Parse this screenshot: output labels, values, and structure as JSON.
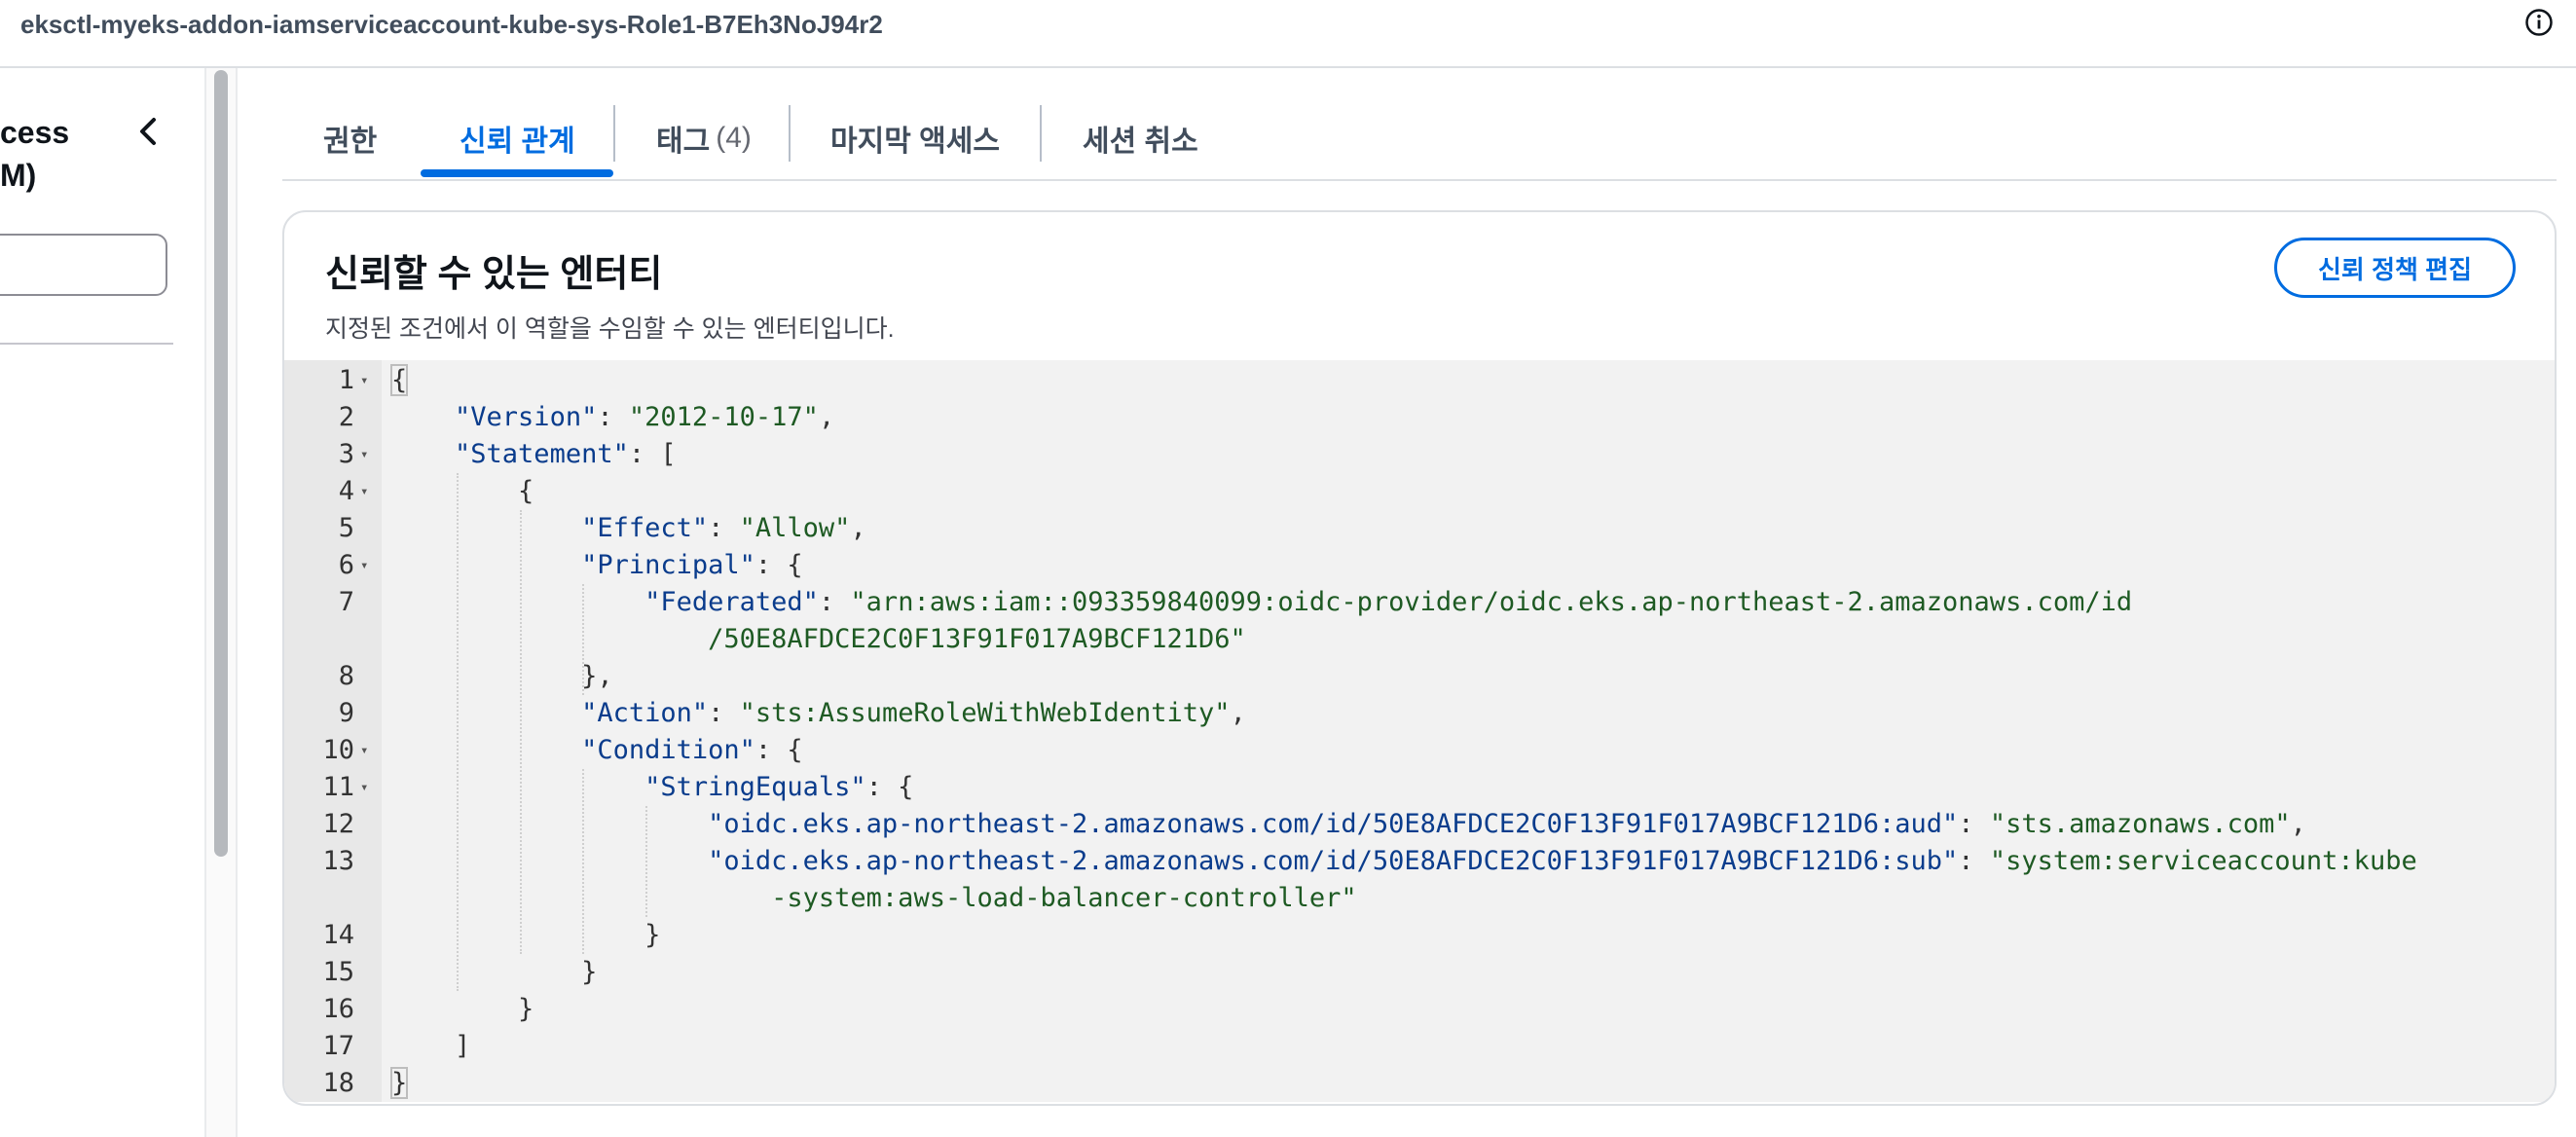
{
  "header": {
    "role_name": "eksctl-myeks-addon-iamserviceaccount-kube-sys-Role1-B7Eh3NoJ94r2",
    "info_icon": "info-icon"
  },
  "leftnav": {
    "title_line1": "cess",
    "title_line2": "M)",
    "collapse_icon": "chevron-left-icon"
  },
  "tabs": [
    {
      "label": "권한",
      "count": "",
      "active": false
    },
    {
      "label": "신뢰 관계",
      "count": "",
      "active": true
    },
    {
      "label": "태그",
      "count": "(4)",
      "active": false
    },
    {
      "label": "마지막 액세스",
      "count": "",
      "active": false
    },
    {
      "label": "세션 취소",
      "count": "",
      "active": false
    }
  ],
  "panel": {
    "title": "신뢰할 수 있는 엔터티",
    "description": "지정된 조건에서 이 역할을 수임할 수 있는 엔터티입니다.",
    "edit_button": "신뢰 정책 편집"
  },
  "code": {
    "lines": [
      {
        "n": "1",
        "fold": true
      },
      {
        "n": "2",
        "fold": false
      },
      {
        "n": "3",
        "fold": true
      },
      {
        "n": "4",
        "fold": true
      },
      {
        "n": "5",
        "fold": false
      },
      {
        "n": "6",
        "fold": true
      },
      {
        "n": "7",
        "fold": false
      },
      {
        "n": "",
        "fold": false
      },
      {
        "n": "8",
        "fold": false
      },
      {
        "n": "9",
        "fold": false
      },
      {
        "n": "10",
        "fold": true
      },
      {
        "n": "11",
        "fold": true
      },
      {
        "n": "12",
        "fold": false
      },
      {
        "n": "13",
        "fold": false
      },
      {
        "n": "",
        "fold": false
      },
      {
        "n": "14",
        "fold": false
      },
      {
        "n": "15",
        "fold": false
      },
      {
        "n": "16",
        "fold": false
      },
      {
        "n": "17",
        "fold": false
      },
      {
        "n": "18",
        "fold": false
      }
    ],
    "text": [
      "{",
      "    \"Version\": \"2012-10-17\",",
      "    \"Statement\": [",
      "        {",
      "            \"Effect\": \"Allow\",",
      "            \"Principal\": {",
      "                \"Federated\": \"arn:aws:iam::093359840099:oidc-provider/oidc.eks.ap-northeast-2.amazonaws.com/id",
      "                    /50E8AFDCE2C0F13F91F017A9BCF121D6\"",
      "            },",
      "            \"Action\": \"sts:AssumeRoleWithWebIdentity\",",
      "            \"Condition\": {",
      "                \"StringEquals\": {",
      "                    \"oidc.eks.ap-northeast-2.amazonaws.com/id/50E8AFDCE2C0F13F91F017A9BCF121D6:aud\": \"sts.amazonaws.com\",",
      "                    \"oidc.eks.ap-northeast-2.amazonaws.com/id/50E8AFDCE2C0F13F91F017A9BCF121D6:sub\": \"system:serviceaccount:kube",
      "                        -system:aws-load-balancer-controller\"",
      "                }",
      "            }",
      "        }",
      "    ]",
      "}"
    ]
  }
}
